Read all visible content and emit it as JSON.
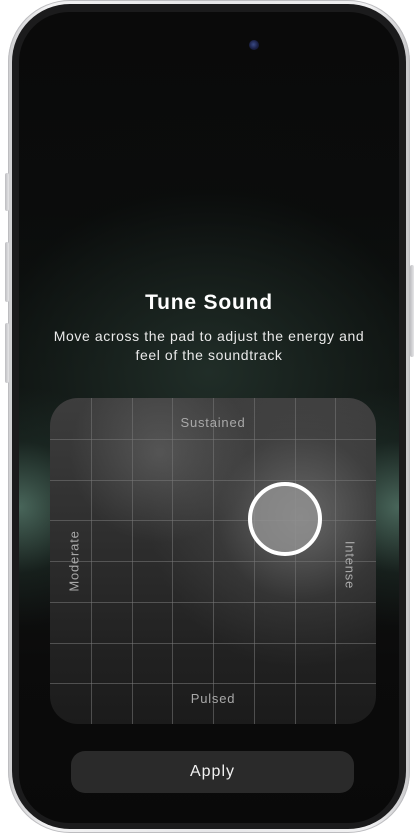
{
  "screen": {
    "title": "Tune Sound",
    "subtitle": "Move across the pad to adjust the energy and feel of the soundtrack"
  },
  "pad": {
    "labels": {
      "top": "Sustained",
      "bottom": "Pulsed",
      "left": "Moderate",
      "right": "Intense"
    },
    "grid_divisions": 8,
    "handle_position": {
      "horizontal": 0.72,
      "vertical_from_top": 0.37
    }
  },
  "actions": {
    "apply_label": "Apply"
  },
  "colors": {
    "screen_background": "#0b0b0b",
    "accent_glow": "#78aa96",
    "pad_background": "#2f2f2f",
    "handle_border": "#ffffff",
    "button_background": "#2a2a2a"
  }
}
